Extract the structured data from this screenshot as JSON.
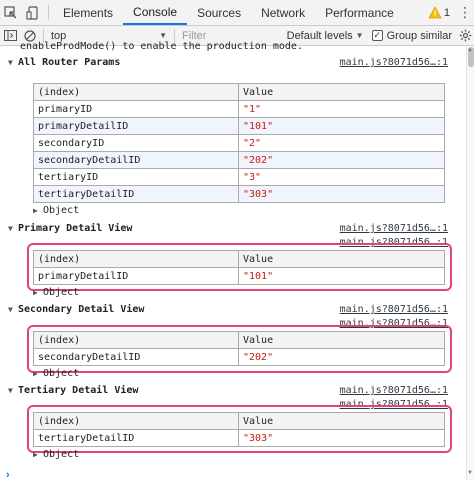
{
  "tabs": {
    "items": [
      {
        "label": "Elements"
      },
      {
        "label": "Console"
      },
      {
        "label": "Sources"
      },
      {
        "label": "Network"
      },
      {
        "label": "Performance"
      }
    ],
    "active_index": 1,
    "warning_count": "1"
  },
  "toolbar": {
    "context": "top",
    "filter_placeholder": "Filter",
    "levels_label": "Default levels",
    "group_similar_label": "Group similar",
    "group_similar_checked": true
  },
  "console": {
    "partial_message": "enableProdMode() to enable the production mode.",
    "groups": [
      {
        "title": "All Router Params",
        "source": "main.js?8071d56…:1",
        "table_headers": [
          "(index)",
          "Value"
        ],
        "rows": [
          {
            "index": "primaryID",
            "value": "\"1\""
          },
          {
            "index": "primaryDetailID",
            "value": "\"101\""
          },
          {
            "index": "secondaryID",
            "value": "\"2\""
          },
          {
            "index": "secondaryDetailID",
            "value": "\"202\""
          },
          {
            "index": "tertiaryID",
            "value": "\"3\""
          },
          {
            "index": "tertiaryDetailID",
            "value": "\"303\""
          }
        ],
        "object_label": "Object"
      },
      {
        "title": "Primary Detail View",
        "source": "main.js?8071d56…:1",
        "table_source": "main.js?8071d56…:1",
        "table_headers": [
          "(index)",
          "Value"
        ],
        "rows": [
          {
            "index": "primaryDetailID",
            "value": "\"101\""
          }
        ],
        "object_label": "Object"
      },
      {
        "title": "Secondary Detail View",
        "source": "main.js?8071d56…:1",
        "table_source": "main.js?8071d56…:1",
        "table_headers": [
          "(index)",
          "Value"
        ],
        "rows": [
          {
            "index": "secondaryDetailID",
            "value": "\"202\""
          }
        ],
        "object_label": "Object"
      },
      {
        "title": "Tertiary Detail View",
        "source": "main.js?8071d56…:1",
        "table_source": "main.js?8071d56…:1",
        "table_headers": [
          "(index)",
          "Value"
        ],
        "rows": [
          {
            "index": "tertiaryDetailID",
            "value": "\"303\""
          }
        ],
        "object_label": "Object"
      }
    ],
    "prompt_symbol": "›"
  },
  "colors": {
    "accent": "#1a73e8",
    "highlight": "#e0457b",
    "string_value": "#c41a16"
  },
  "icons": {
    "inspect": "inspect-element-icon",
    "device": "device-toolbar-icon",
    "sidebar": "console-sidebar-icon",
    "clear": "clear-console-icon",
    "warning": "warning-icon",
    "menu": "more-options-icon",
    "settings": "gear-icon"
  }
}
